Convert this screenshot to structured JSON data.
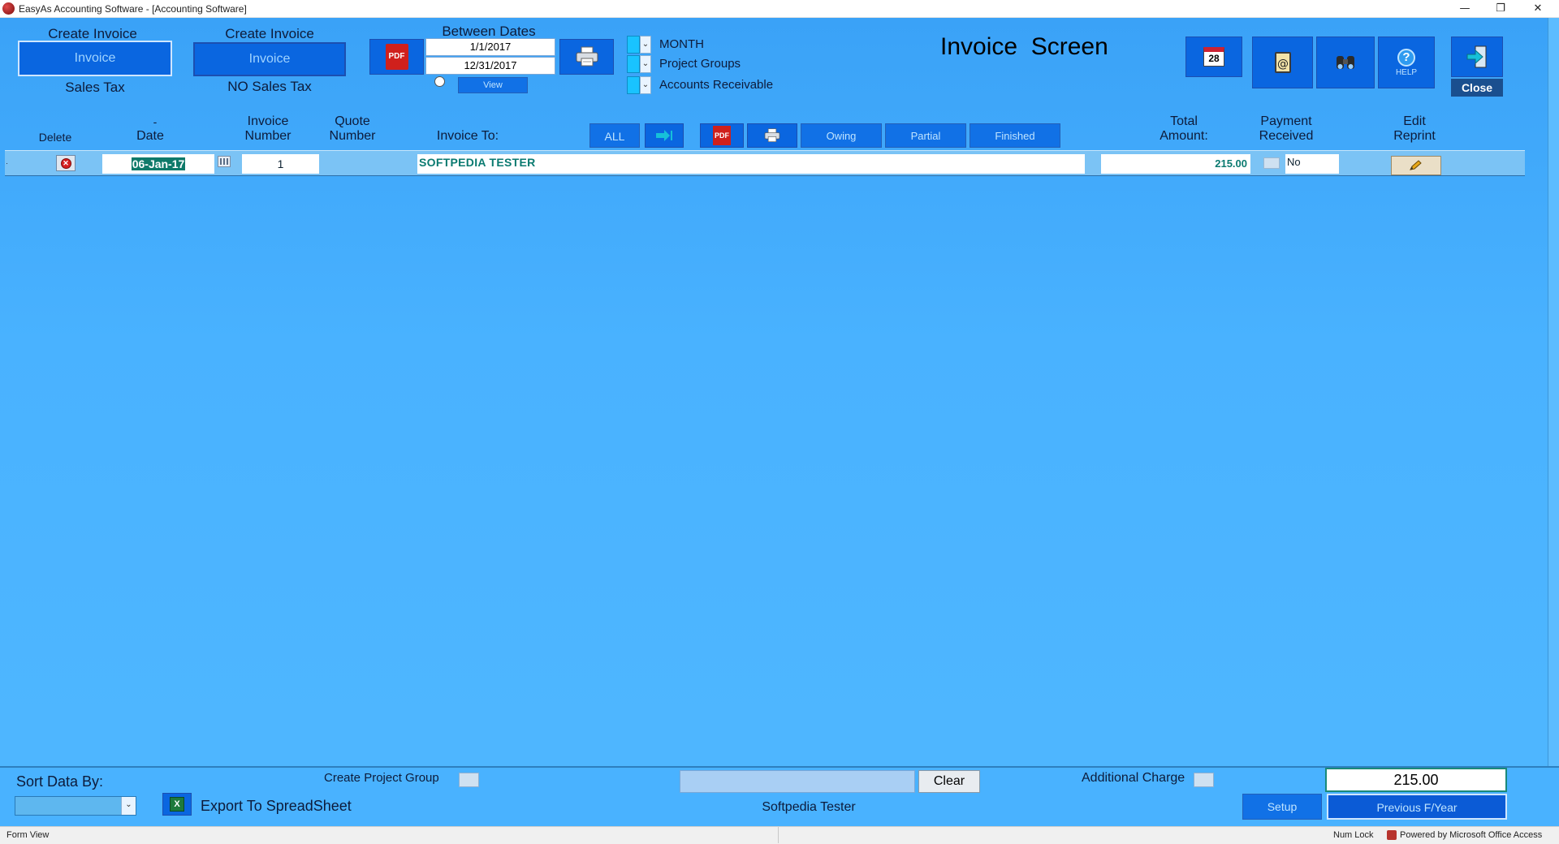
{
  "window": {
    "title": "EasyAs Accounting Software - [Accounting Software]",
    "minimize": "—",
    "restore": "❐",
    "close": "✕"
  },
  "top": {
    "create_invoice_1": {
      "heading": "Create Invoice",
      "button": "Invoice",
      "sub": "Sales Tax"
    },
    "create_invoice_2": {
      "heading": "Create Invoice",
      "button": "Invoice",
      "sub": "NO Sales Tax"
    },
    "between_dates": {
      "label": "Between Dates",
      "from": "1/1/2017",
      "to": "12/31/2017",
      "view": "View"
    },
    "pdf_label": "PDF",
    "filters": [
      "MONTH",
      "Project Groups",
      "Accounts Receivable"
    ],
    "screen_title": "Invoice  Screen",
    "calendar_day": "28",
    "help_label": "HELP",
    "close_label": "Close"
  },
  "headers": {
    "delete": "Delete",
    "date_dash": "-",
    "date": "Date",
    "invoice_number": [
      "Invoice",
      "Number"
    ],
    "quote_number": [
      "Quote",
      "Number"
    ],
    "invoice_to": "Invoice To:",
    "all": "ALL",
    "owing": "Owing",
    "partial": "Partial",
    "finished": "Finished",
    "total_amount": [
      "Total",
      "Amount:"
    ],
    "payment_received": [
      "Payment",
      "Received"
    ],
    "edit_reprint": [
      "Edit",
      "Reprint"
    ]
  },
  "rows": [
    {
      "date": "06-Jan-17",
      "invoice_number": "1",
      "invoice_to": "SOFTPEDIA TESTER",
      "total": "215.00",
      "payment_received": "No"
    }
  ],
  "footer": {
    "sort_label": "Sort Data By:",
    "sort_value": "",
    "create_project_group": "Create Project Group",
    "search_value": "",
    "clear": "Clear",
    "customer_name": "Softpedia Tester",
    "additional_charge": "Additional Charge",
    "total": "215.00",
    "setup": "Setup",
    "previous_fy": "Previous F/Year",
    "export": "Export To SpreadSheet"
  },
  "statusbar": {
    "left": "Form View",
    "num_lock": "Num Lock",
    "powered": "Powered by Microsoft Office Access"
  },
  "colors": {
    "form_bg": "#4fb7ff",
    "button_blue": "#0a66e0",
    "pdf_red": "#d0201c"
  }
}
